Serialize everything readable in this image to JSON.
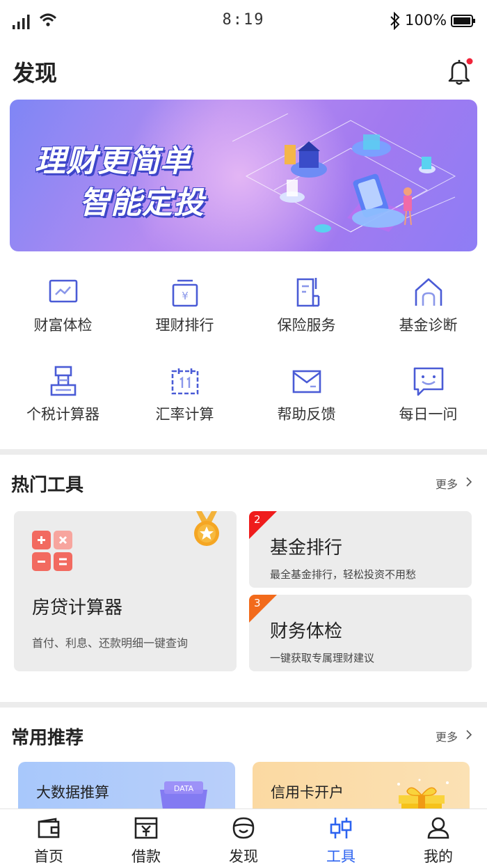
{
  "status_bar": {
    "time": "8:19",
    "battery": "100%"
  },
  "header": {
    "title": "发现",
    "bell_icon": "bell-icon",
    "badge_color": "#f0243a"
  },
  "banner": {
    "line1": "理财更简单",
    "line2": "智能定投"
  },
  "quick_grid": [
    {
      "label": "财富体检",
      "icon": "chart-icon"
    },
    {
      "label": "理财排行",
      "icon": "yuan-box-icon"
    },
    {
      "label": "保险服务",
      "icon": "document-icon"
    },
    {
      "label": "基金诊断",
      "icon": "house-icon"
    },
    {
      "label": "个税计算器",
      "icon": "tax-icon"
    },
    {
      "label": "汇率计算",
      "icon": "calendar-icon"
    },
    {
      "label": "帮助反馈",
      "icon": "mail-icon"
    },
    {
      "label": "每日一问",
      "icon": "chat-smile-icon"
    }
  ],
  "hot_tools": {
    "title": "热门工具",
    "more": "更多",
    "featured": {
      "title": "房贷计算器",
      "desc": "首付、利息、还款明细一键查询"
    },
    "items": [
      {
        "rank": "2",
        "title": "基金排行",
        "desc": "最全基金排行，轻松投资不用愁",
        "badge_color": "#ef1c1c"
      },
      {
        "rank": "3",
        "title": "财务体检",
        "desc": "一键获取专属理财建议",
        "badge_color": "#f26a1b"
      }
    ]
  },
  "recommend": {
    "title": "常用推荐",
    "more": "更多",
    "items": [
      {
        "title": "大数据推算",
        "tag": "DATA"
      },
      {
        "title": "信用卡开户"
      }
    ]
  },
  "tabs": [
    {
      "label": "首页",
      "icon": "wallet-icon",
      "active": false
    },
    {
      "label": "借款",
      "icon": "loan-icon",
      "active": false
    },
    {
      "label": "发现",
      "icon": "discover-icon",
      "active": false
    },
    {
      "label": "工具",
      "icon": "tools-icon",
      "active": true
    },
    {
      "label": "我的",
      "icon": "user-icon",
      "active": false
    }
  ],
  "colors": {
    "accent": "#2c63f0",
    "icon_blue": "#4a5bd6",
    "divider": "#ececec"
  }
}
